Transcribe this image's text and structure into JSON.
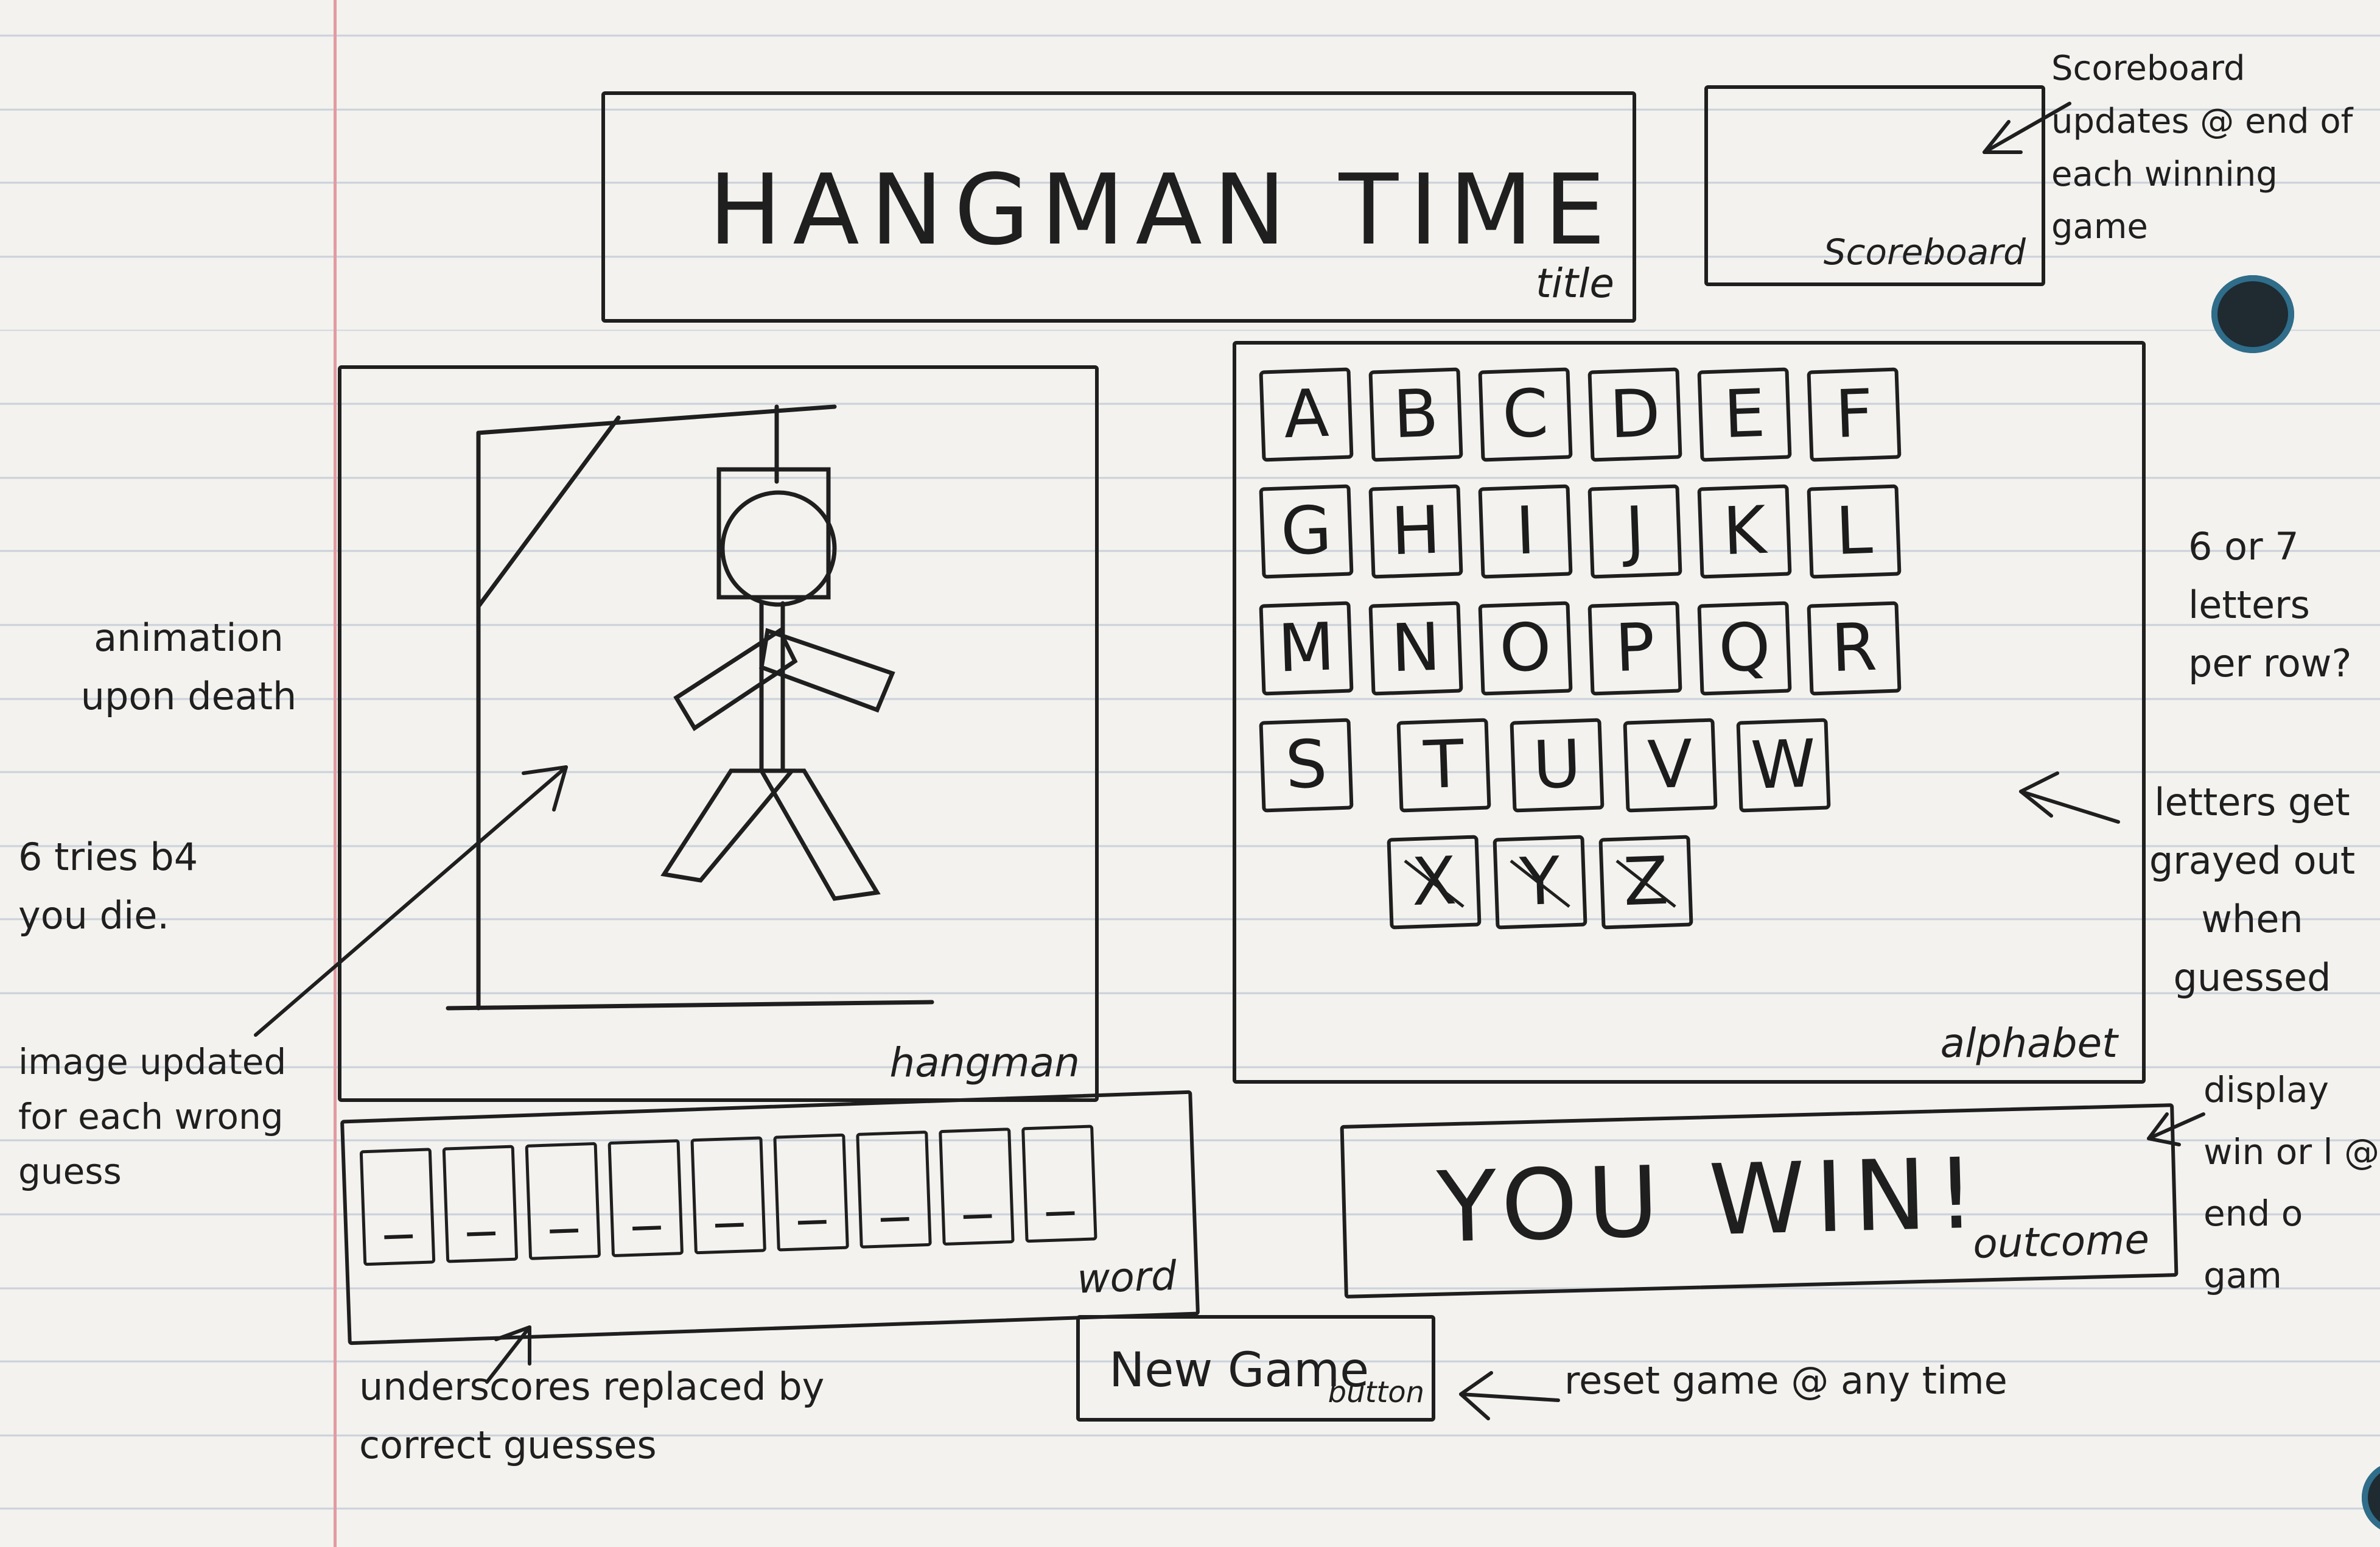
{
  "title": {
    "text": "HANGMAN TIME",
    "label": "title"
  },
  "scoreboard": {
    "label": "Scoreboard",
    "note": "Scoreboard updates @ end of each winning game"
  },
  "hangman": {
    "label": "hangman",
    "notes": {
      "animation": "animation upon death",
      "tries": "6 tries b4 you die.",
      "image": "image updated for each wrong guess"
    }
  },
  "alphabet": {
    "label": "alphabet",
    "rows": [
      [
        "A",
        "B",
        "C",
        "D",
        "E",
        "F"
      ],
      [
        "G",
        "H",
        "I",
        "J",
        "K",
        "L"
      ],
      [
        "M",
        "N",
        "O",
        "P",
        "Q",
        "R"
      ],
      [
        "S",
        "T",
        "U",
        "V",
        "W"
      ],
      [
        "X",
        "Y",
        "Z"
      ]
    ],
    "notes": {
      "per_row": "6 or 7 letters per row?",
      "grayed": "letters get grayed out when guessed"
    }
  },
  "word": {
    "label": "word",
    "slots": [
      "_",
      "_",
      "_",
      "_",
      "_",
      "_",
      "_",
      "_",
      "_"
    ],
    "note": "underscores replaced by correct guesses"
  },
  "outcome": {
    "text": "YOU WIN!",
    "label": "outcome",
    "note": "display win or l @ end o gam"
  },
  "new_game": {
    "text": "New Game",
    "label": "button",
    "note": "reset game @ any time"
  },
  "colors": {
    "paper": "#f3f2ee",
    "ink": "#1f1f1f",
    "rule": "#a9b6c9",
    "margin": "#e39aa1"
  }
}
